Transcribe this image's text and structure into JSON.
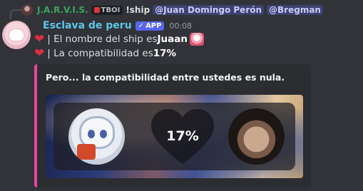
{
  "reply": {
    "author": "J.A.R.V.I.S.",
    "tag": "TBOI",
    "command": "!ship",
    "mentions": [
      "@Juan Domingo Perón",
      "@Bregman"
    ]
  },
  "message": {
    "author": "Esclava de peru",
    "badge": "APP",
    "timestamp": "00:08",
    "line1_prefix": "| El nombre del ship es ",
    "ship_name": "Juaan",
    "line2_prefix": "| La compatibilidad es ",
    "compatibility": "17%"
  },
  "embed": {
    "title": "Pero... la compatibilidad entre ustedes es nula.",
    "percent_label": "17%",
    "accent_color": "#eb459e"
  },
  "icons": {
    "heart": "red-heart-icon",
    "badge_check": "check-icon"
  }
}
